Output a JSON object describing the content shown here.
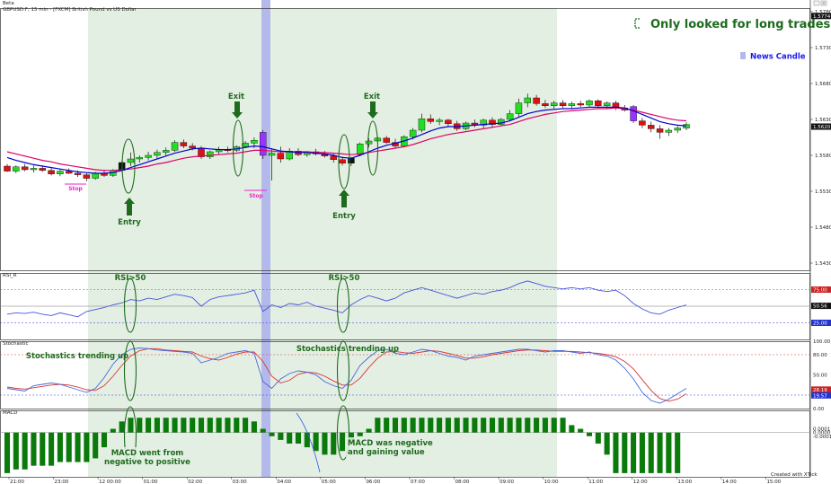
{
  "window": {
    "title": "Beta",
    "subtitle": "GBPUSD.F, 15 min - [FXCM] British Pound vs US Dollar"
  },
  "legend": {
    "long_trades": "Only looked for long trades",
    "news_candle": "News Candle"
  },
  "annotations": {
    "exit_1": "Exit",
    "exit_2": "Exit",
    "entry_1": "Entry",
    "entry_2": "Entry",
    "stop_1": "Stop",
    "stop_2": "Stop",
    "rsi_1": "RSI>50",
    "rsi_2": "RSI>50",
    "stoch_1": "Stochastics trending up",
    "stoch_2": "Stochastics trending up",
    "macd_1_line1": "MACD went from",
    "macd_1_line2": "negative to positive",
    "macd_2_line1": "MACD was negative",
    "macd_2_line2": "and gaining value"
  },
  "panes": {
    "rsi_label": "RSI_R",
    "stoch_label": "Stochastic",
    "macd_label": "MACD"
  },
  "footer": "Created with XTick",
  "colors": {
    "bull": "#22dd22",
    "bear": "#dd1111",
    "news": "#9933ff",
    "ma_fast": "#0000cc",
    "ma_slow": "#dd0066",
    "session": "#e4efe3",
    "news_band": "#b3b9ea",
    "annotation": "#1e6b1e",
    "rsi_line": "#4455dd",
    "stoch_k": "#4466dd",
    "stoch_d": "#dd3333",
    "macd_hist": "#0a7a0a"
  },
  "chart_data": [
    {
      "type": "candlestick",
      "title": "GBPUSD.F, 15 min - [FXCM] British Pound vs US Dollar",
      "ylim": [
        1.542,
        1.5785
      ],
      "y_ticks": [
        "1.5780",
        "1.5730",
        "1.5680",
        "1.5630",
        "1.5580",
        "1.5530",
        "1.5480",
        "1.5430"
      ],
      "price_tags": [
        "1.5774",
        "1.5620"
      ],
      "x_ticks": [
        "21:00",
        "23:00",
        "12 00:00",
        "01:00",
        "02:00",
        "03:00",
        "04:00",
        "05:00",
        "06:00",
        "07:00",
        "08:00",
        "09:00",
        "10:00",
        "11:00",
        "12:00",
        "13:00",
        "14:00",
        "15:00"
      ],
      "candles": [
        [
          1.5565,
          1.5568,
          1.5557,
          1.5558
        ],
        [
          1.5558,
          1.5566,
          1.5555,
          1.5564
        ],
        [
          1.5564,
          1.5568,
          1.5558,
          1.556
        ],
        [
          1.556,
          1.5566,
          1.5556,
          1.5562
        ],
        [
          1.5562,
          1.5566,
          1.5557,
          1.5559
        ],
        [
          1.5559,
          1.5562,
          1.5552,
          1.5554
        ],
        [
          1.5554,
          1.5561,
          1.5551,
          1.5558
        ],
        [
          1.5558,
          1.5562,
          1.5554,
          1.5555
        ],
        [
          1.5555,
          1.5559,
          1.555,
          1.5553
        ],
        [
          1.5553,
          1.5556,
          1.5544,
          1.5548
        ],
        [
          1.5548,
          1.5557,
          1.5546,
          1.5555
        ],
        [
          1.5555,
          1.556,
          1.555,
          1.5552
        ],
        [
          1.5552,
          1.5561,
          1.555,
          1.5559
        ],
        [
          1.5559,
          1.5572,
          1.5557,
          1.557
        ],
        [
          1.557,
          1.5584,
          1.5565,
          1.5575
        ],
        [
          1.5575,
          1.558,
          1.557,
          1.5577
        ],
        [
          1.5577,
          1.5585,
          1.5573,
          1.558
        ],
        [
          1.558,
          1.5588,
          1.5576,
          1.5584
        ],
        [
          1.5584,
          1.5591,
          1.558,
          1.5587
        ],
        [
          1.5587,
          1.5601,
          1.5585,
          1.5598
        ],
        [
          1.5598,
          1.5602,
          1.559,
          1.5593
        ],
        [
          1.5593,
          1.5597,
          1.5587,
          1.559
        ],
        [
          1.559,
          1.5593,
          1.5575,
          1.5578
        ],
        [
          1.5578,
          1.5587,
          1.5575,
          1.5585
        ],
        [
          1.5585,
          1.5592,
          1.5581,
          1.5588
        ],
        [
          1.5588,
          1.5592,
          1.5584,
          1.5587
        ],
        [
          1.5587,
          1.5594,
          1.5585,
          1.5592
        ],
        [
          1.5592,
          1.56,
          1.559,
          1.5597
        ],
        [
          1.5597,
          1.5605,
          1.559,
          1.5601
        ],
        [
          1.5612,
          1.5615,
          1.5575,
          1.558
        ],
        [
          1.558,
          1.559,
          1.5545,
          1.5583
        ],
        [
          1.5583,
          1.5592,
          1.557,
          1.5575
        ],
        [
          1.5575,
          1.559,
          1.5573,
          1.5586
        ],
        [
          1.5586,
          1.559,
          1.5579,
          1.5581
        ],
        [
          1.5581,
          1.5586,
          1.5578,
          1.5585
        ],
        [
          1.5585,
          1.5589,
          1.558,
          1.5582
        ],
        [
          1.5582,
          1.5586,
          1.5577,
          1.5579
        ],
        [
          1.5579,
          1.5582,
          1.557,
          1.5574
        ],
        [
          1.5574,
          1.5578,
          1.5566,
          1.5569
        ],
        [
          1.5569,
          1.5578,
          1.5565,
          1.5576
        ],
        [
          1.5581,
          1.5598,
          1.5579,
          1.5596
        ],
        [
          1.5596,
          1.5604,
          1.5591,
          1.56
        ],
        [
          1.56,
          1.5606,
          1.5592,
          1.5604
        ],
        [
          1.5604,
          1.5607,
          1.5596,
          1.5598
        ],
        [
          1.5598,
          1.5603,
          1.559,
          1.5593
        ],
        [
          1.5593,
          1.5608,
          1.5591,
          1.5606
        ],
        [
          1.5606,
          1.5618,
          1.5602,
          1.5615
        ],
        [
          1.5615,
          1.5638,
          1.5612,
          1.5631
        ],
        [
          1.5631,
          1.5637,
          1.5624,
          1.5627
        ],
        [
          1.5627,
          1.5632,
          1.5622,
          1.5629
        ],
        [
          1.5629,
          1.5631,
          1.562,
          1.5624
        ],
        [
          1.5624,
          1.5628,
          1.5614,
          1.5617
        ],
        [
          1.5617,
          1.5627,
          1.5615,
          1.5625
        ],
        [
          1.5625,
          1.563,
          1.5619,
          1.5622
        ],
        [
          1.5622,
          1.5631,
          1.5618,
          1.5629
        ],
        [
          1.5629,
          1.5633,
          1.5618,
          1.5623
        ],
        [
          1.5623,
          1.5632,
          1.5621,
          1.563
        ],
        [
          1.563,
          1.5643,
          1.5628,
          1.5638
        ],
        [
          1.5638,
          1.5659,
          1.5633,
          1.5653
        ],
        [
          1.5653,
          1.5666,
          1.5647,
          1.566
        ],
        [
          1.566,
          1.5664,
          1.5649,
          1.5652
        ],
        [
          1.5652,
          1.5657,
          1.5646,
          1.5649
        ],
        [
          1.5649,
          1.5656,
          1.5645,
          1.5653
        ],
        [
          1.5653,
          1.5657,
          1.5646,
          1.5649
        ],
        [
          1.5649,
          1.5655,
          1.5645,
          1.5652
        ],
        [
          1.5652,
          1.5656,
          1.5647,
          1.565
        ],
        [
          1.565,
          1.5658,
          1.5648,
          1.5656
        ],
        [
          1.5656,
          1.5658,
          1.5646,
          1.5649
        ],
        [
          1.5649,
          1.5655,
          1.5645,
          1.5653
        ],
        [
          1.5653,
          1.5656,
          1.5643,
          1.5646
        ],
        [
          1.5646,
          1.565,
          1.5641,
          1.5643
        ],
        [
          1.5648,
          1.565,
          1.5625,
          1.5628
        ],
        [
          1.5628,
          1.5632,
          1.5618,
          1.5622
        ],
        [
          1.5622,
          1.5627,
          1.5612,
          1.5617
        ],
        [
          1.5617,
          1.5622,
          1.5603,
          1.5612
        ],
        [
          1.5612,
          1.5618,
          1.5607,
          1.5615
        ],
        [
          1.5615,
          1.5621,
          1.5611,
          1.5618
        ],
        [
          1.5618,
          1.5626,
          1.5615,
          1.5623
        ]
      ],
      "news_candles": [
        29,
        71
      ],
      "series": [
        {
          "name": "Fast MA",
          "values": [
            1.5577,
            1.5573,
            1.557,
            1.5567,
            1.5565,
            1.5563,
            1.5561,
            1.5559,
            1.5557,
            1.5556,
            1.5555,
            1.5555,
            1.5556,
            1.5559,
            1.5563,
            1.5567,
            1.5571,
            1.5575,
            1.5579,
            1.5583,
            1.5586,
            1.5589,
            1.559,
            1.5589,
            1.5588,
            1.5588,
            1.5589,
            1.5591,
            1.5593,
            1.5592,
            1.5589,
            1.5586,
            1.5585,
            1.5584,
            1.5584,
            1.5583,
            1.5582,
            1.558,
            1.5577,
            1.5576,
            1.558,
            1.5585,
            1.559,
            1.5594,
            1.5597,
            1.56,
            1.5604,
            1.5609,
            1.5614,
            1.5618,
            1.562,
            1.562,
            1.5621,
            1.5622,
            1.5623,
            1.5624,
            1.5625,
            1.5628,
            1.5633,
            1.5638,
            1.5641,
            1.5643,
            1.5644,
            1.5645,
            1.5645,
            1.5646,
            1.5647,
            1.5647,
            1.5647,
            1.5647,
            1.5646,
            1.5642,
            1.5637,
            1.5632,
            1.5627,
            1.5624,
            1.5622,
            1.5621
          ]
        },
        {
          "name": "Slow MA",
          "values": [
            1.5585,
            1.5582,
            1.5579,
            1.5576,
            1.5573,
            1.5571,
            1.5568,
            1.5566,
            1.5564,
            1.5562,
            1.556,
            1.5559,
            1.5559,
            1.556,
            1.5561,
            1.5563,
            1.5565,
            1.5568,
            1.557,
            1.5573,
            1.5576,
            1.5578,
            1.5579,
            1.558,
            1.5581,
            1.5582,
            1.5583,
            1.5585,
            1.5587,
            1.5587,
            1.5586,
            1.5585,
            1.5585,
            1.5585,
            1.5585,
            1.5584,
            1.5584,
            1.5583,
            1.5582,
            1.5581,
            1.5582,
            1.5584,
            1.5586,
            1.5588,
            1.559,
            1.5592,
            1.5595,
            1.5599,
            1.5603,
            1.5606,
            1.5609,
            1.5611,
            1.5613,
            1.5615,
            1.5617,
            1.5619,
            1.5621,
            1.5623,
            1.5627,
            1.5631,
            1.5634,
            1.5637,
            1.5639,
            1.5641,
            1.5642,
            1.5643,
            1.5644,
            1.5645,
            1.5645,
            1.5646,
            1.5645,
            1.5643,
            1.564,
            1.5637,
            1.5634,
            1.5631,
            1.5629,
            1.5628
          ]
        }
      ]
    },
    {
      "type": "line",
      "title": "RSI_R",
      "ylim": [
        0,
        100
      ],
      "levels": [
        75,
        50
      ],
      "y_ticks": [
        "75.00",
        "50.56",
        "25.00"
      ],
      "series": [
        {
          "name": "RSI",
          "values": [
            38,
            40,
            39,
            41,
            38,
            36,
            40,
            37,
            34,
            42,
            45,
            48,
            52,
            55,
            60,
            58,
            62,
            60,
            64,
            68,
            66,
            63,
            50,
            60,
            64,
            66,
            68,
            70,
            74,
            42,
            52,
            48,
            54,
            52,
            56,
            50,
            47,
            44,
            40,
            52,
            60,
            66,
            62,
            58,
            62,
            70,
            74,
            78,
            74,
            70,
            66,
            62,
            66,
            70,
            68,
            72,
            74,
            78,
            84,
            88,
            84,
            80,
            78,
            76,
            78,
            76,
            78,
            74,
            72,
            74,
            66,
            54,
            46,
            40,
            38,
            44,
            48,
            52
          ]
        }
      ]
    },
    {
      "type": "line",
      "title": "Stochastic",
      "ylim": [
        0,
        100
      ],
      "levels": [
        80,
        20
      ],
      "y_ticks": [
        "100.00",
        "80.00",
        "50.00",
        "28.19",
        "19.57",
        "0.00"
      ],
      "series": [
        {
          "name": "%K",
          "values": [
            30,
            28,
            26,
            34,
            36,
            38,
            36,
            32,
            28,
            24,
            30,
            46,
            66,
            80,
            88,
            90,
            89,
            87,
            86,
            85,
            84,
            82,
            68,
            72,
            76,
            82,
            84,
            86,
            82,
            40,
            30,
            44,
            52,
            56,
            54,
            50,
            40,
            34,
            30,
            42,
            64,
            76,
            86,
            88,
            82,
            80,
            84,
            88,
            86,
            82,
            78,
            76,
            72,
            78,
            80,
            82,
            84,
            86,
            88,
            88,
            86,
            84,
            86,
            86,
            84,
            82,
            84,
            80,
            78,
            72,
            60,
            44,
            24,
            12,
            8,
            14,
            22,
            30
          ]
        },
        {
          "name": "%D",
          "values": [
            32,
            30,
            29,
            31,
            33,
            35,
            36,
            35,
            32,
            28,
            27,
            34,
            48,
            64,
            78,
            86,
            89,
            89,
            87,
            86,
            85,
            84,
            78,
            74,
            72,
            76,
            81,
            84,
            84,
            70,
            48,
            38,
            42,
            51,
            54,
            53,
            48,
            41,
            35,
            35,
            45,
            61,
            75,
            84,
            85,
            83,
            82,
            84,
            86,
            85,
            82,
            79,
            75,
            75,
            77,
            80,
            82,
            84,
            86,
            87,
            87,
            86,
            85,
            85,
            85,
            84,
            83,
            82,
            80,
            77,
            70,
            59,
            43,
            27,
            15,
            11,
            14,
            22
          ]
        }
      ]
    },
    {
      "type": "bar",
      "title": "MACD",
      "ylim": [
        -0.0012,
        0.0006
      ],
      "y_ticks": [
        "0.0001",
        "0.0000",
        "-0.0001"
      ],
      "values": [
        -0.0011,
        -0.001,
        -0.001,
        -0.0009,
        -0.0009,
        -0.0009,
        -0.0008,
        -0.0008,
        -0.0008,
        -0.0008,
        -0.0007,
        -0.0004,
        0.0001,
        0.0003,
        0.0004,
        0.0004,
        0.0004,
        0.0004,
        0.0004,
        0.0004,
        0.0004,
        0.0004,
        0.0004,
        0.0004,
        0.0004,
        0.0004,
        0.0004,
        0.0004,
        0.0003,
        0.0001,
        -0.0001,
        -0.0002,
        -0.0003,
        -0.0003,
        -0.0004,
        -0.0005,
        -0.0006,
        -0.0006,
        -0.0005,
        -0.0003,
        -0.0001,
        0.0001,
        0.0004,
        0.0004,
        0.0004,
        0.0004,
        0.0004,
        0.0004,
        0.0004,
        0.0004,
        0.0004,
        0.0004,
        0.0004,
        0.0004,
        0.0004,
        0.0004,
        0.0004,
        0.0004,
        0.0004,
        0.0004,
        0.0004,
        0.0004,
        0.0004,
        0.0004,
        0.0002,
        0.0001,
        -0.0001,
        -0.0003,
        -0.0006,
        -0.0011,
        -0.0011,
        -0.0011,
        -0.0011,
        -0.0011,
        -0.0011,
        -0.0011,
        -0.0011
      ]
    }
  ]
}
